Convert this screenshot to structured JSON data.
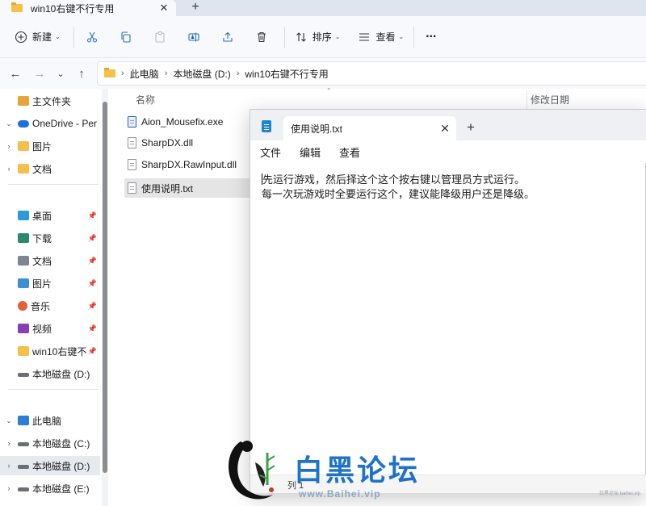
{
  "explorer": {
    "tab": {
      "title": "win10右键不行专用",
      "close": "✕"
    },
    "new_tab": "+",
    "toolbar": {
      "new_label": "新建",
      "sort_label": "排序",
      "view_label": "查看",
      "more": "···"
    },
    "nav": {
      "back": "←",
      "forward": "→",
      "recent": "⌄",
      "up": "↑"
    },
    "breadcrumbs": [
      "此电脑",
      "本地磁盘 (D:)",
      "win10右键不行专用"
    ],
    "sidebar": {
      "items": [
        {
          "label": "主文件夹",
          "expand": "",
          "icon": "home-icon",
          "color": "#e8a33a"
        },
        {
          "label": "OneDrive - Per",
          "expand": "⌄",
          "icon": "cloud-icon",
          "color": "#1a73d9"
        },
        {
          "label": "图片",
          "expand": "›",
          "icon": "folder-icon",
          "color": "#f4c04a"
        },
        {
          "label": "文档",
          "expand": "›",
          "icon": "folder-icon",
          "color": "#f4c04a"
        },
        {
          "label": "桌面",
          "expand": "",
          "icon": "desktop-icon",
          "color": "#2c9ad8",
          "pinned": true
        },
        {
          "label": "下载",
          "expand": "",
          "icon": "download-icon",
          "color": "#2a8a6e",
          "pinned": true
        },
        {
          "label": "文档",
          "expand": "",
          "icon": "document-icon",
          "color": "#7d8794",
          "pinned": true
        },
        {
          "label": "图片",
          "expand": "",
          "icon": "pictures-icon",
          "color": "#3d8fd4",
          "pinned": true
        },
        {
          "label": "音乐",
          "expand": "",
          "icon": "music-icon",
          "color": "#e0613a",
          "pinned": true
        },
        {
          "label": "视频",
          "expand": "",
          "icon": "video-icon",
          "color": "#8a3fb5",
          "pinned": true
        },
        {
          "label": "win10右键不",
          "expand": "",
          "icon": "folder-icon",
          "color": "#f4c04a",
          "pinned": true
        },
        {
          "label": "本地磁盘 (D:)",
          "expand": "",
          "icon": "drive-icon",
          "color": "#6b6f75"
        },
        {
          "label": "此电脑",
          "expand": "⌄",
          "icon": "computer-icon",
          "color": "#2c7fd6"
        },
        {
          "label": "本地磁盘 (C:)",
          "expand": "›",
          "icon": "drive-icon",
          "color": "#6b6f75"
        },
        {
          "label": "本地磁盘 (D:)",
          "expand": "›",
          "icon": "drive-icon",
          "color": "#6b6f75",
          "selected": true
        },
        {
          "label": "本地磁盘 (E:)",
          "expand": "›",
          "icon": "drive-icon",
          "color": "#6b6f75"
        }
      ],
      "pin_glyph": "📌"
    },
    "columns": {
      "name": "名称",
      "modified": "修改日期"
    },
    "files": [
      {
        "name": "Aion_Mousefix.exe",
        "type": "exe"
      },
      {
        "name": "SharpDX.dll",
        "type": "dll"
      },
      {
        "name": "SharpDX.RawInput.dll",
        "type": "dll"
      },
      {
        "name": "使用说明.txt",
        "type": "txt",
        "selected": true
      }
    ]
  },
  "notepad": {
    "tab_title": "使用说明.txt",
    "close": "✕",
    "new_tab": "+",
    "menus": [
      "文件",
      "编辑",
      "查看"
    ],
    "content_lines": [
      "先运行游戏，然后择这个这个按右键以管理员方式运行。",
      "每一次玩游戏时全要运行这个，建议能降级用户还是降级。"
    ],
    "status": "列 1"
  },
  "watermark": {
    "text": "白黑论坛",
    "url": "www.Baihei.vip",
    "corner": "白黑论坛 baihei.vip"
  }
}
